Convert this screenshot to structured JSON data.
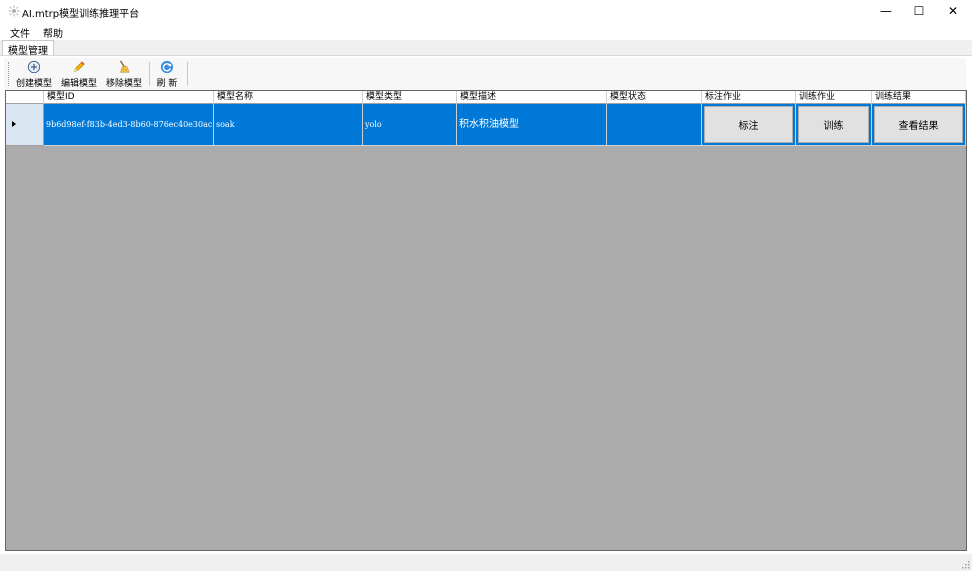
{
  "window": {
    "title": "AI.mtrp模型训练推理平台",
    "minimize_glyph": "—",
    "maximize_glyph": "☐",
    "close_glyph": "✕"
  },
  "menu": {
    "items": [
      "文件",
      "帮助"
    ]
  },
  "tabs": [
    "模型管理"
  ],
  "toolbar": {
    "create_label": "创建模型",
    "create_icon": "add-circle-icon",
    "edit_label": "编辑模型",
    "edit_icon": "pencil-icon",
    "remove_label": "移除模型",
    "remove_icon": "broom-icon",
    "refresh_label": "刷 新",
    "refresh_icon": "refresh-icon"
  },
  "grid": {
    "columns": [
      "模型ID",
      "模型名称",
      "模型类型",
      "模型描述",
      "模型状态",
      "标注作业",
      "训练作业",
      "训练结果"
    ],
    "rows": [
      {
        "id": "9b6d98ef-f83b-4ed3-8b60-876ec40e30ac",
        "name": "soak",
        "type": "yolo",
        "description": "积水积油模型",
        "status": "",
        "annotate_label": "标注",
        "train_label": "训练",
        "result_label": "查看结果"
      }
    ]
  },
  "colors": {
    "selection": "#0078d7",
    "grid_background": "#ababab",
    "button_face": "#e1e1e1"
  }
}
